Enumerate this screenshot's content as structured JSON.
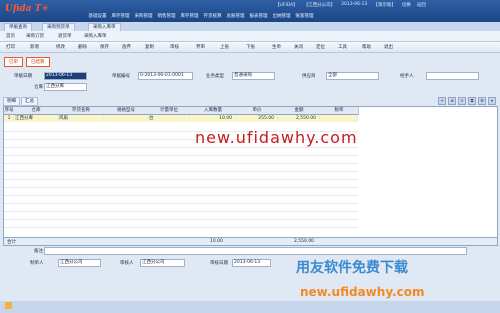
{
  "app": {
    "logo": "Ufida T+"
  },
  "topbar": {
    "menu": [
      "基础设置",
      "库存管理",
      "采购管理",
      "销售管理",
      "库存管理",
      "存货核算",
      "总账管理",
      "报表管理",
      "出纳管理",
      "账套管理"
    ],
    "right": [
      "【UFIDA】",
      "【江西分公司】",
      "2013-06-13",
      "【演示账】",
      "切换",
      "返回"
    ]
  },
  "doc_tabs": [
    "单据查询",
    "采购到货单",
    "采购入库单"
  ],
  "nav2": [
    "首页",
    "采购订货",
    "退货单",
    "采购入库单"
  ],
  "toolbar": [
    "打印",
    "新增",
    "修改",
    "删除",
    "保存",
    "放弃",
    "复制",
    "审核",
    "弃审",
    "上张",
    "下张",
    "生单",
    "关闭",
    "定位",
    "工具",
    "帮助",
    "退出"
  ],
  "status_buttons": [
    "已审",
    "已结算"
  ],
  "header": {
    "date_label": "单据日期",
    "date_value": "2013-06-13",
    "code_label": "单据编号",
    "code_value": "0-2013-06-01-0001",
    "type_label": "业务类型",
    "type_value": "普通采购",
    "supplier_label": "供应商",
    "supplier_value": "全部",
    "handler_label": "经手人",
    "handler_value": "",
    "warehouse_label": "仓库",
    "warehouse_value": "江西分库"
  },
  "subtabs": [
    "明细",
    "汇总"
  ],
  "grid": {
    "columns": [
      "序号",
      "仓库",
      "存货名称",
      "规格型号",
      "计量单位",
      "入库数量",
      "单价",
      "金额",
      "税率"
    ],
    "rows": [
      {
        "no": "1",
        "warehouse": "江西分库",
        "item": "风扇",
        "spec": "",
        "unit": "台",
        "qty": "10.00",
        "price": "255.00",
        "amount": "2,550.00",
        "tax": ""
      }
    ]
  },
  "totals": {
    "label": "合计",
    "qty": "10.00",
    "amount": "2,550.00"
  },
  "footer": {
    "memo_label": "备注",
    "maker_label": "制单人",
    "maker_value": "江西分公司",
    "auditor_label": "审核人",
    "auditor_value": "江西分公司",
    "audit_date_label": "审核日期",
    "audit_date_value": "2013-06-13"
  },
  "watermarks": [
    "new.ufidawhy.com",
    "用友软件免费下载",
    "new.ufidawhy.com"
  ]
}
